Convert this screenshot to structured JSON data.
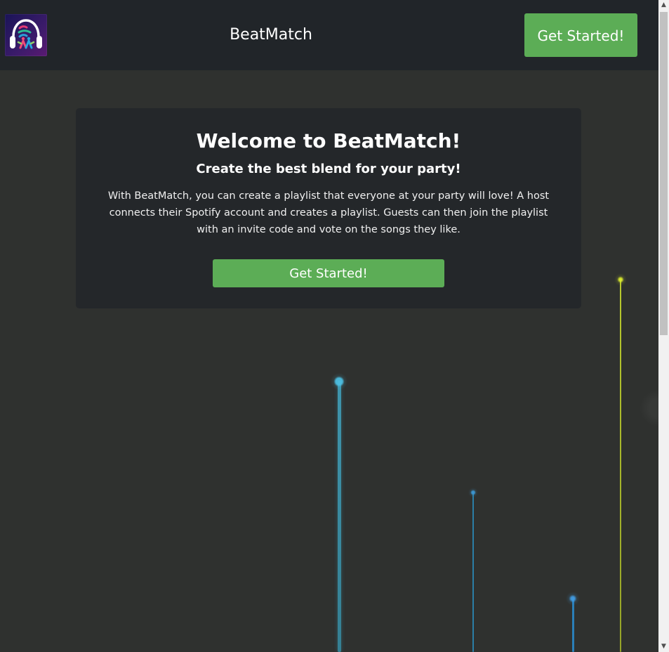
{
  "header": {
    "brand": "BeatMatch",
    "cta_label": "Get Started!",
    "logo_icon": "headphones-logo-icon"
  },
  "hero": {
    "title": "Welcome to BeatMatch!",
    "subtitle": "Create the best blend for your party!",
    "body": "With BeatMatch, you can create a playlist that everyone at your party will love! A host connects their Spotify account and creates a playlist. Guests can then join the playlist with an invite code and vote on the songs they like.",
    "cta_label": "Get Started!"
  },
  "colors": {
    "header_bg": "#212529",
    "page_bg": "#2f312f",
    "card_bg": "#24272a",
    "accent_green": "#5cad56",
    "beam_blue": "#3ea2c0",
    "beam_yellow": "#d4e22f"
  },
  "scrollbar": {
    "up_icon": "scroll-up-arrow-icon",
    "down_icon": "scroll-down-arrow-icon"
  }
}
